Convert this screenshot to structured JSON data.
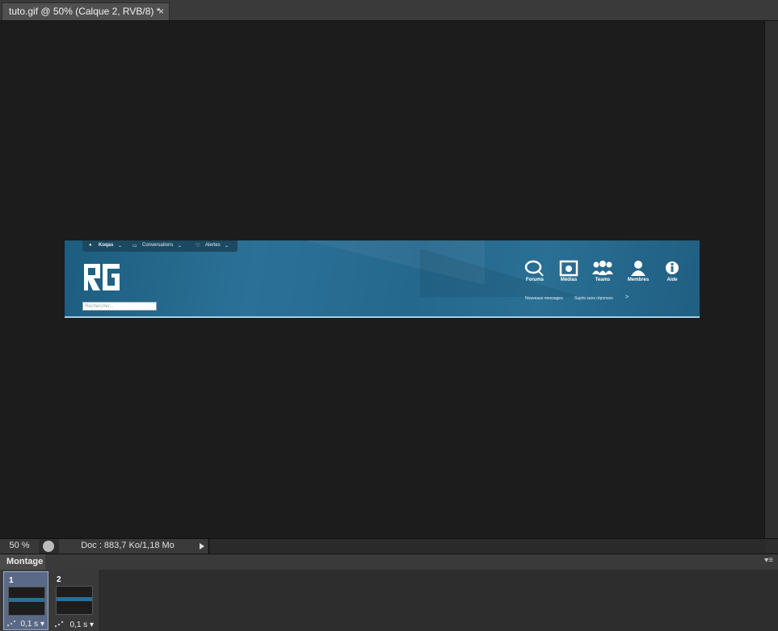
{
  "document": {
    "tab_title": "tuto.gif @ 50% (Calque 2, RVB/8) *",
    "close_glyph": "×"
  },
  "banner": {
    "topnav": {
      "user": "Koqas",
      "conversations": "Conversations",
      "alerts": "Alertes"
    },
    "search_placeholder": "Rechercher...",
    "nav": [
      {
        "label": "Forums",
        "icon": "chat-bubbles-icon"
      },
      {
        "label": "Médias",
        "icon": "camera-icon"
      },
      {
        "label": "Teams",
        "icon": "group-icon"
      },
      {
        "label": "Membres",
        "icon": "user-icon"
      },
      {
        "label": "Aide",
        "icon": "info-icon"
      }
    ],
    "subnav": {
      "new_messages": "Nouveaux messages",
      "unanswered": "Sujets sans réponses",
      "more": ">"
    },
    "colors": {
      "banner": "#2a6f94",
      "topnav": "#1c4962"
    }
  },
  "status": {
    "zoom": "50 %",
    "doc_info": "Doc : 883,7 Ko/1,18 Mo"
  },
  "timeline": {
    "panel_title": "Montage",
    "frames": [
      {
        "number": "1",
        "delay": "0,1 s"
      },
      {
        "number": "2",
        "delay": "0,1 s"
      }
    ]
  }
}
